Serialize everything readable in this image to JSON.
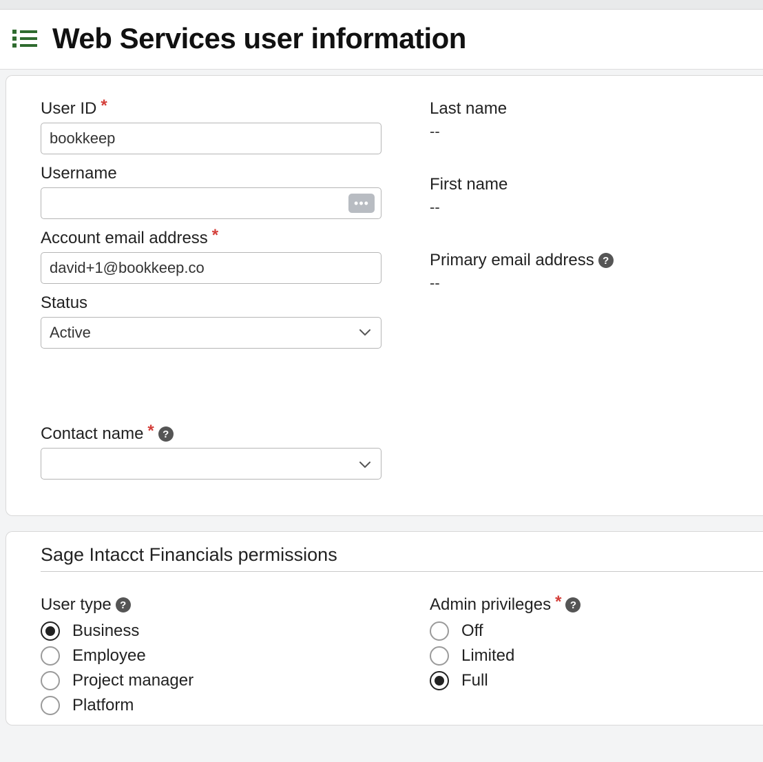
{
  "header": {
    "title": "Web Services user information"
  },
  "fields": {
    "user_id": {
      "label": "User ID",
      "value": "bookkeep"
    },
    "username": {
      "label": "Username",
      "value": ""
    },
    "account_email": {
      "label": "Account email address",
      "value": "david+1@bookkeep.co"
    },
    "status": {
      "label": "Status",
      "value": "Active"
    },
    "contact_name": {
      "label": "Contact name",
      "value": ""
    },
    "last_name": {
      "label": "Last name",
      "value": "--"
    },
    "first_name": {
      "label": "First name",
      "value": "--"
    },
    "primary_email": {
      "label": "Primary email address",
      "value": "--"
    }
  },
  "permissions": {
    "section_title": "Sage Intacct Financials permissions",
    "user_type": {
      "label": "User type",
      "options": {
        "business": "Business",
        "employee": "Employee",
        "project_manager": "Project manager",
        "platform": "Platform"
      },
      "selected": "business"
    },
    "admin_privileges": {
      "label": "Admin privileges",
      "options": {
        "off": "Off",
        "limited": "Limited",
        "full": "Full"
      },
      "selected": "full"
    }
  }
}
